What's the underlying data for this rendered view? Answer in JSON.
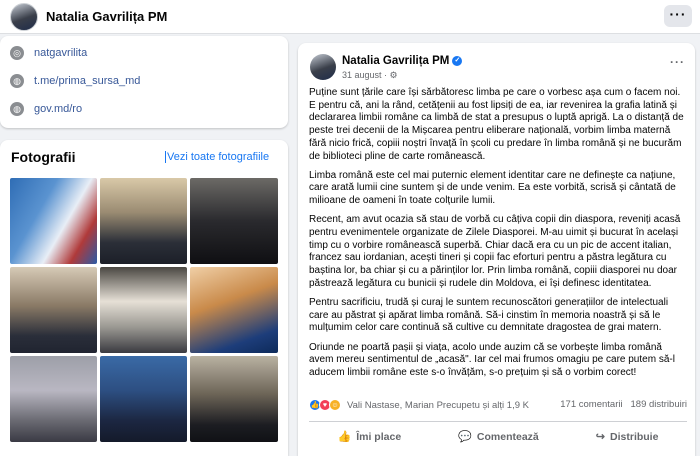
{
  "page": {
    "name": "Natalia Gavrilița PM",
    "more_label": "···"
  },
  "intro": {
    "links": [
      {
        "icon": "instagram-icon",
        "glyph": "◎",
        "label": "natgavrilita"
      },
      {
        "icon": "globe-icon",
        "glyph": "◍",
        "label": "t.me/prima_sursa_md"
      },
      {
        "icon": "globe-icon",
        "glyph": "◍",
        "label": "gov.md/ro"
      }
    ]
  },
  "photos": {
    "title": "Fotografii",
    "see_all": "Vezi toate fotografiile"
  },
  "post": {
    "author": "Natalia Gavrilița PM",
    "verified_glyph": "✓",
    "date": "31 august · ⚙",
    "more_label": "···",
    "paragraphs": [
      "Puține sunt țările care își sărbătoresc limba pe care o vorbesc așa cum o facem noi. E pentru că, ani la rând, cetățenii au fost lipsiți de ea, iar revenirea la grafia latină și declararea limbii române ca limbă de stat a presupus o luptă aprigă. La o distanță de peste trei decenii de la Mișcarea pentru eliberare națională, vorbim limba maternă fără nicio frică, copiii noștri învață în școli cu predare în limba română și ne bucurăm de biblioteci pline de carte românească.",
      "Limba română este cel mai puternic element identitar care ne definește ca națiune, care arată lumii cine suntem și de unde venim. Ea este vorbită, scrisă și cântată de milioane de oameni în toate colțurile lumii.",
      "Recent, am avut ocazia să stau de vorbă cu câțiva copii din diaspora, reveniți acasă pentru evenimentele organizate de Zilele Diasporei. M-au uimit și bucurat în același timp cu o vorbire românească superbă. Chiar dacă era cu un pic de accent italian, francez sau iordanian, acești tineri și copii fac eforturi pentru a păstra legătura cu baștina lor, ba chiar și cu a părinților lor. Prin limba română, copiii diasporei nu doar păstrează legătura cu bunicii și rudele din Moldova, ei își definesc identitatea.",
      "Pentru sacrificiu, trudă și curaj le suntem recunoscători generațiilor de intelectuali care au păstrat și apărat limba română. Să-i cinstim în memoria noastră și să le mulțumim celor care continuă să cultive cu demnitate dragostea de grai matern.",
      "Oriunde ne poartă pașii și viața, acolo unde auzim că se vorbește limba română avem mereu sentimentul de „acasă\". Iar cel mai frumos omagiu pe care putem să-l aducem limbii române este s-o învățăm, s-o prețuim și să o vorbim corect!"
    ],
    "reactions_text": "Vali Nastase, Marian Precupetu și alți 1,9 K",
    "comments_count": "171 comentarii",
    "shares_count": "189 distribuiri",
    "actions": [
      {
        "icon": "like-icon",
        "glyph": "👍",
        "label": "Îmi place"
      },
      {
        "icon": "comment-icon",
        "glyph": "💬",
        "label": "Comentează"
      },
      {
        "icon": "share-icon",
        "glyph": "↪",
        "label": "Distribuie"
      }
    ]
  },
  "colors": {
    "link": "#385898",
    "accent": "#1877f2",
    "muted": "#65676b",
    "background": "#f0f2f5"
  }
}
